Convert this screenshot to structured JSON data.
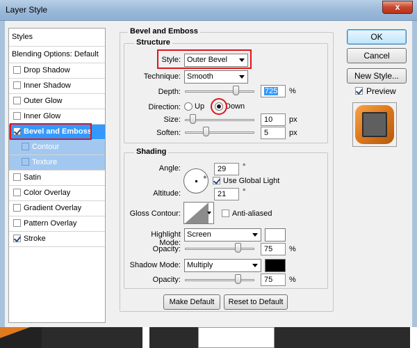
{
  "window": {
    "title": "Layer Style",
    "close_glyph": "x"
  },
  "styles_list": {
    "header": "Styles",
    "blending": "Blending Options: Default",
    "items": [
      {
        "label": "Drop Shadow",
        "checked": false
      },
      {
        "label": "Inner Shadow",
        "checked": false
      },
      {
        "label": "Outer Glow",
        "checked": false
      },
      {
        "label": "Inner Glow",
        "checked": false
      },
      {
        "label": "Bevel and Emboss",
        "checked": true,
        "selected": true
      },
      {
        "label": "Contour",
        "checked": false,
        "sub": true
      },
      {
        "label": "Texture",
        "checked": false,
        "sub": true
      },
      {
        "label": "Satin",
        "checked": false
      },
      {
        "label": "Color Overlay",
        "checked": false
      },
      {
        "label": "Gradient Overlay",
        "checked": false
      },
      {
        "label": "Pattern Overlay",
        "checked": false
      },
      {
        "label": "Stroke",
        "checked": true
      }
    ]
  },
  "bevel": {
    "section_title": "Bevel and Emboss",
    "structure_title": "Structure",
    "style_label": "Style:",
    "style_value": "Outer Bevel",
    "technique_label": "Technique:",
    "technique_value": "Smooth",
    "depth_label": "Depth:",
    "depth_value": "725",
    "depth_unit": "%",
    "direction_label": "Direction:",
    "direction_up": "Up",
    "direction_down": "Down",
    "size_label": "Size:",
    "size_value": "10",
    "size_unit": "px",
    "soften_label": "Soften:",
    "soften_value": "5",
    "soften_unit": "px"
  },
  "shading": {
    "title": "Shading",
    "angle_label": "Angle:",
    "angle_value": "29",
    "angle_unit": "°",
    "global_light_label": "Use Global Light",
    "altitude_label": "Altitude:",
    "altitude_value": "21",
    "altitude_unit": "°",
    "gloss_label": "Gloss Contour:",
    "antialiased_label": "Anti-aliased",
    "highlight_mode_label": "Highlight Mode:",
    "highlight_mode_value": "Screen",
    "highlight_color": "#ffffff",
    "opacity_label": "Opacity:",
    "highlight_opacity": "75",
    "opacity_unit": "%",
    "shadow_mode_label": "Shadow Mode:",
    "shadow_mode_value": "Multiply",
    "shadow_color": "#000000",
    "shadow_opacity": "75"
  },
  "buttons": {
    "make_default": "Make Default",
    "reset_default": "Reset to Default",
    "ok": "OK",
    "cancel": "Cancel",
    "new_style": "New Style...",
    "preview": "Preview"
  },
  "colors": {
    "accent": "#3399ff",
    "highlight_red": "#e0141a",
    "preview_orange": "#e07a1e"
  }
}
